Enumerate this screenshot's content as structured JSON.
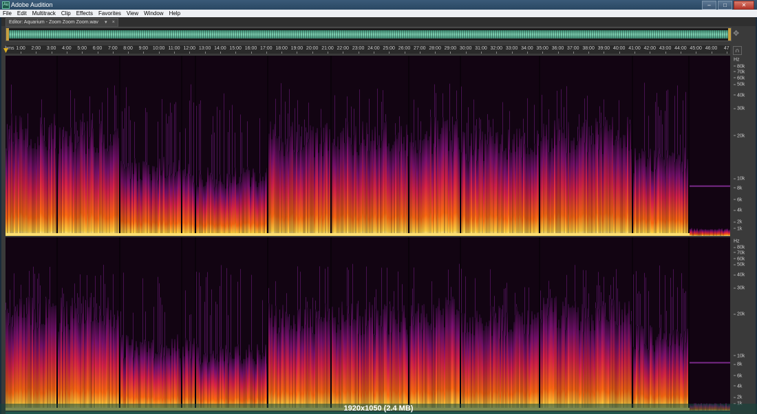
{
  "window": {
    "title": "Adobe Audition",
    "icon": "adobe-audition-icon",
    "minimize": "–",
    "maximize": "□",
    "close": "✕"
  },
  "menu": [
    "File",
    "Edit",
    "Multitrack",
    "Clip",
    "Effects",
    "Favorites",
    "View",
    "Window",
    "Help"
  ],
  "editor_tab": {
    "label": "Editor: Aquarium - Zoom Zoom Zoom.wav",
    "dropdown": "▼",
    "close": "×"
  },
  "ruler": {
    "unit": "hms",
    "ticks": [
      "1:00",
      "2:00",
      "3:00",
      "4:00",
      "5:00",
      "6:00",
      "7:00",
      "8:00",
      "9:00",
      "10:00",
      "11:00",
      "12:00",
      "13:00",
      "14:00",
      "15:00",
      "16:00",
      "17:00",
      "18:00",
      "19:00",
      "20:00",
      "21:00",
      "22:00",
      "23:00",
      "24:00",
      "25:00",
      "26:00",
      "27:00",
      "28:00",
      "29:00",
      "30:00",
      "31:00",
      "32:00",
      "33:00",
      "34:00",
      "35:00",
      "36:00",
      "37:00",
      "38:00",
      "39:00",
      "40:00",
      "41:00",
      "42:00",
      "43:00",
      "44:00",
      "45:00",
      "46:00",
      "47"
    ]
  },
  "frequency_scale": {
    "unit": "Hz",
    "labels": [
      "80k",
      "70k",
      "60k",
      "50k",
      "40k",
      "30k",
      "20k",
      "10k",
      "8k",
      "6k",
      "4k",
      "2k",
      "1k"
    ]
  },
  "colors": {
    "accent": "#c8a040",
    "waveform": "#7fd2b4",
    "spectrogram_bg": "#120412"
  },
  "overlay_caption": "1920x1050 (2.4 MB)"
}
